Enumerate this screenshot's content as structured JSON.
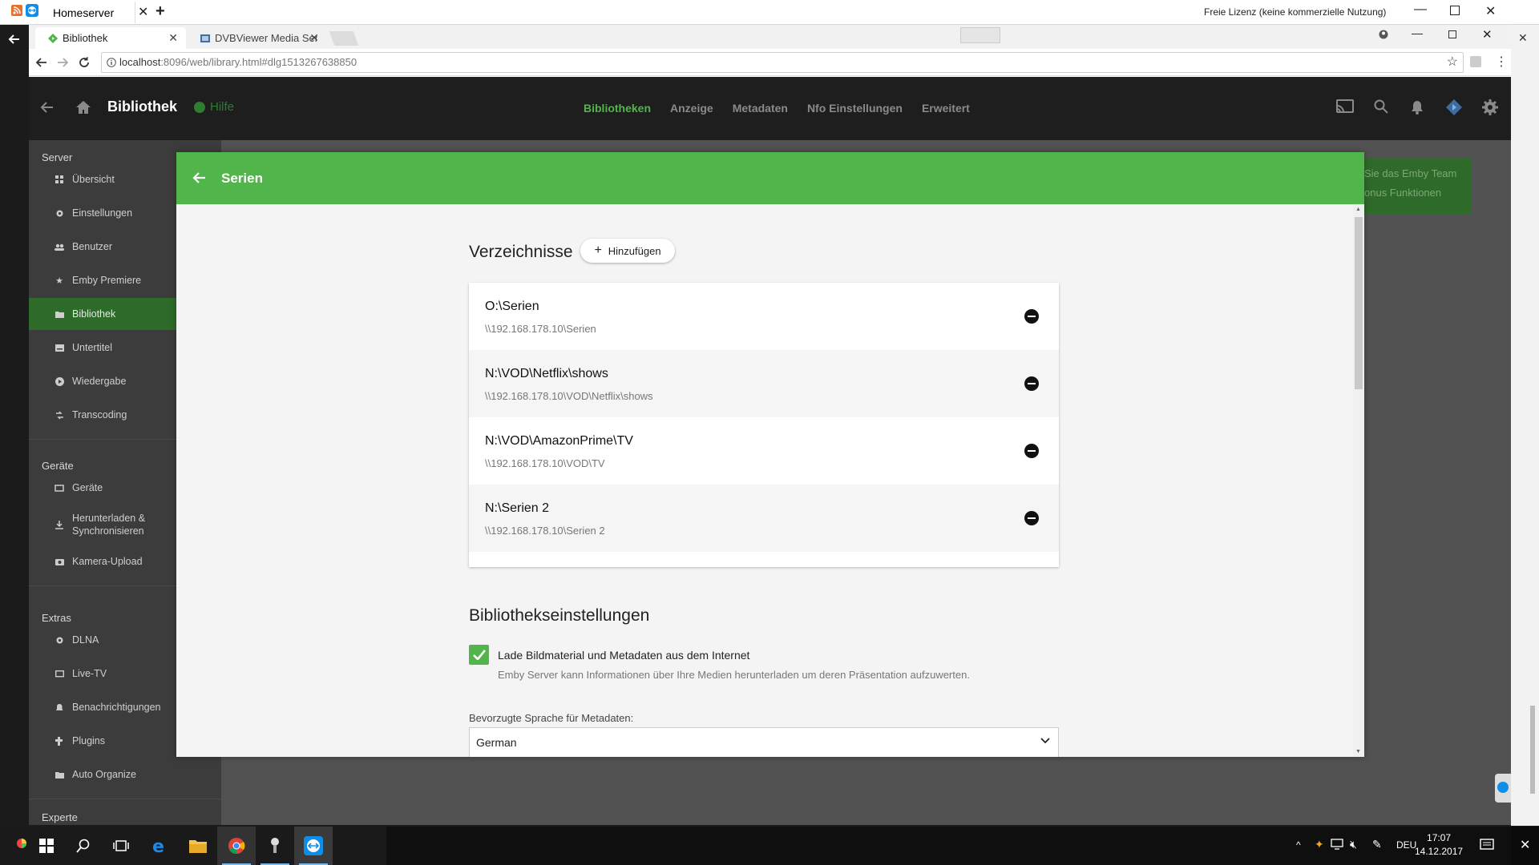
{
  "remote": {
    "tab_title": "Homeserver",
    "license_text": "Freie Lizenz (keine kommerzielle Nutzung)"
  },
  "browser": {
    "tabs": [
      {
        "title": "Bibliothek"
      },
      {
        "title": "DVBViewer Media Server"
      }
    ],
    "url_host": "localhost",
    "url_rest": ":8096/web/library.html#dlg1513267638850"
  },
  "emby": {
    "header_title": "Bibliothek",
    "help_label": "Hilfe",
    "nav": [
      {
        "label": "Bibliotheken",
        "active": true
      },
      {
        "label": "Anzeige",
        "active": false
      },
      {
        "label": "Metadaten",
        "active": false
      },
      {
        "label": "Nfo Einstellungen",
        "active": false
      },
      {
        "label": "Erweitert",
        "active": false
      }
    ],
    "accent_color": "#52b54b"
  },
  "sidebar": {
    "server_heading": "Server",
    "server_items": [
      {
        "label": "Übersicht",
        "icon": "dashboard-icon"
      },
      {
        "label": "Einstellungen",
        "icon": "gear-icon"
      },
      {
        "label": "Benutzer",
        "icon": "people-icon"
      },
      {
        "label": "Emby Premiere",
        "icon": "star-icon"
      },
      {
        "label": "Bibliothek",
        "icon": "folder-icon",
        "active": true
      },
      {
        "label": "Untertitel",
        "icon": "subtitles-icon"
      },
      {
        "label": "Wiedergabe",
        "icon": "play-circle-icon"
      },
      {
        "label": "Transcoding",
        "icon": "transform-icon"
      }
    ],
    "devices_heading": "Geräte",
    "devices_items": [
      {
        "label": "Geräte",
        "icon": "devices-icon"
      },
      {
        "label": "Herunterladen & Synchronisieren",
        "icon": "download-icon"
      },
      {
        "label": "Kamera-Upload",
        "icon": "camera-icon"
      }
    ],
    "extras_heading": "Extras",
    "extras_items": [
      {
        "label": "DLNA",
        "icon": "settings-icon"
      },
      {
        "label": "Live-TV",
        "icon": "tv-icon"
      },
      {
        "label": "Benachrichtigungen",
        "icon": "bell-icon"
      },
      {
        "label": "Plugins",
        "icon": "plugin-icon"
      },
      {
        "label": "Auto Organize",
        "icon": "folder-icon"
      }
    ],
    "expert_heading": "Experte"
  },
  "promo": {
    "line1": "Sie das Emby Team",
    "line2": "onus Funktionen"
  },
  "dialog": {
    "title": "Serien",
    "folders_heading": "Verzeichnisse",
    "add_button": "Hinzufügen",
    "folders": [
      {
        "name": "O:\\Serien",
        "path": "\\\\192.168.178.10\\Serien"
      },
      {
        "name": "N:\\VOD\\Netflix\\shows",
        "path": "\\\\192.168.178.10\\VOD\\Netflix\\shows"
      },
      {
        "name": "N:\\VOD\\AmazonPrime\\TV",
        "path": "\\\\192.168.178.10\\VOD\\TV"
      },
      {
        "name": "N:\\Serien 2",
        "path": "\\\\192.168.178.10\\Serien 2"
      }
    ],
    "library_heading": "Bibliothekseinstellungen",
    "download_images_label": "Lade Bildmaterial und Metadaten aus dem Internet",
    "download_images_checked": true,
    "download_images_desc": "Emby Server kann Informationen über Ihre Medien herunterladen um deren Präsentation aufzuwerten.",
    "language_label": "Bevorzugte Sprache für Metadaten:",
    "language_value": "German"
  },
  "taskbar": {
    "lang": "DEU",
    "time": "17:07",
    "date": "14.12.2017"
  }
}
